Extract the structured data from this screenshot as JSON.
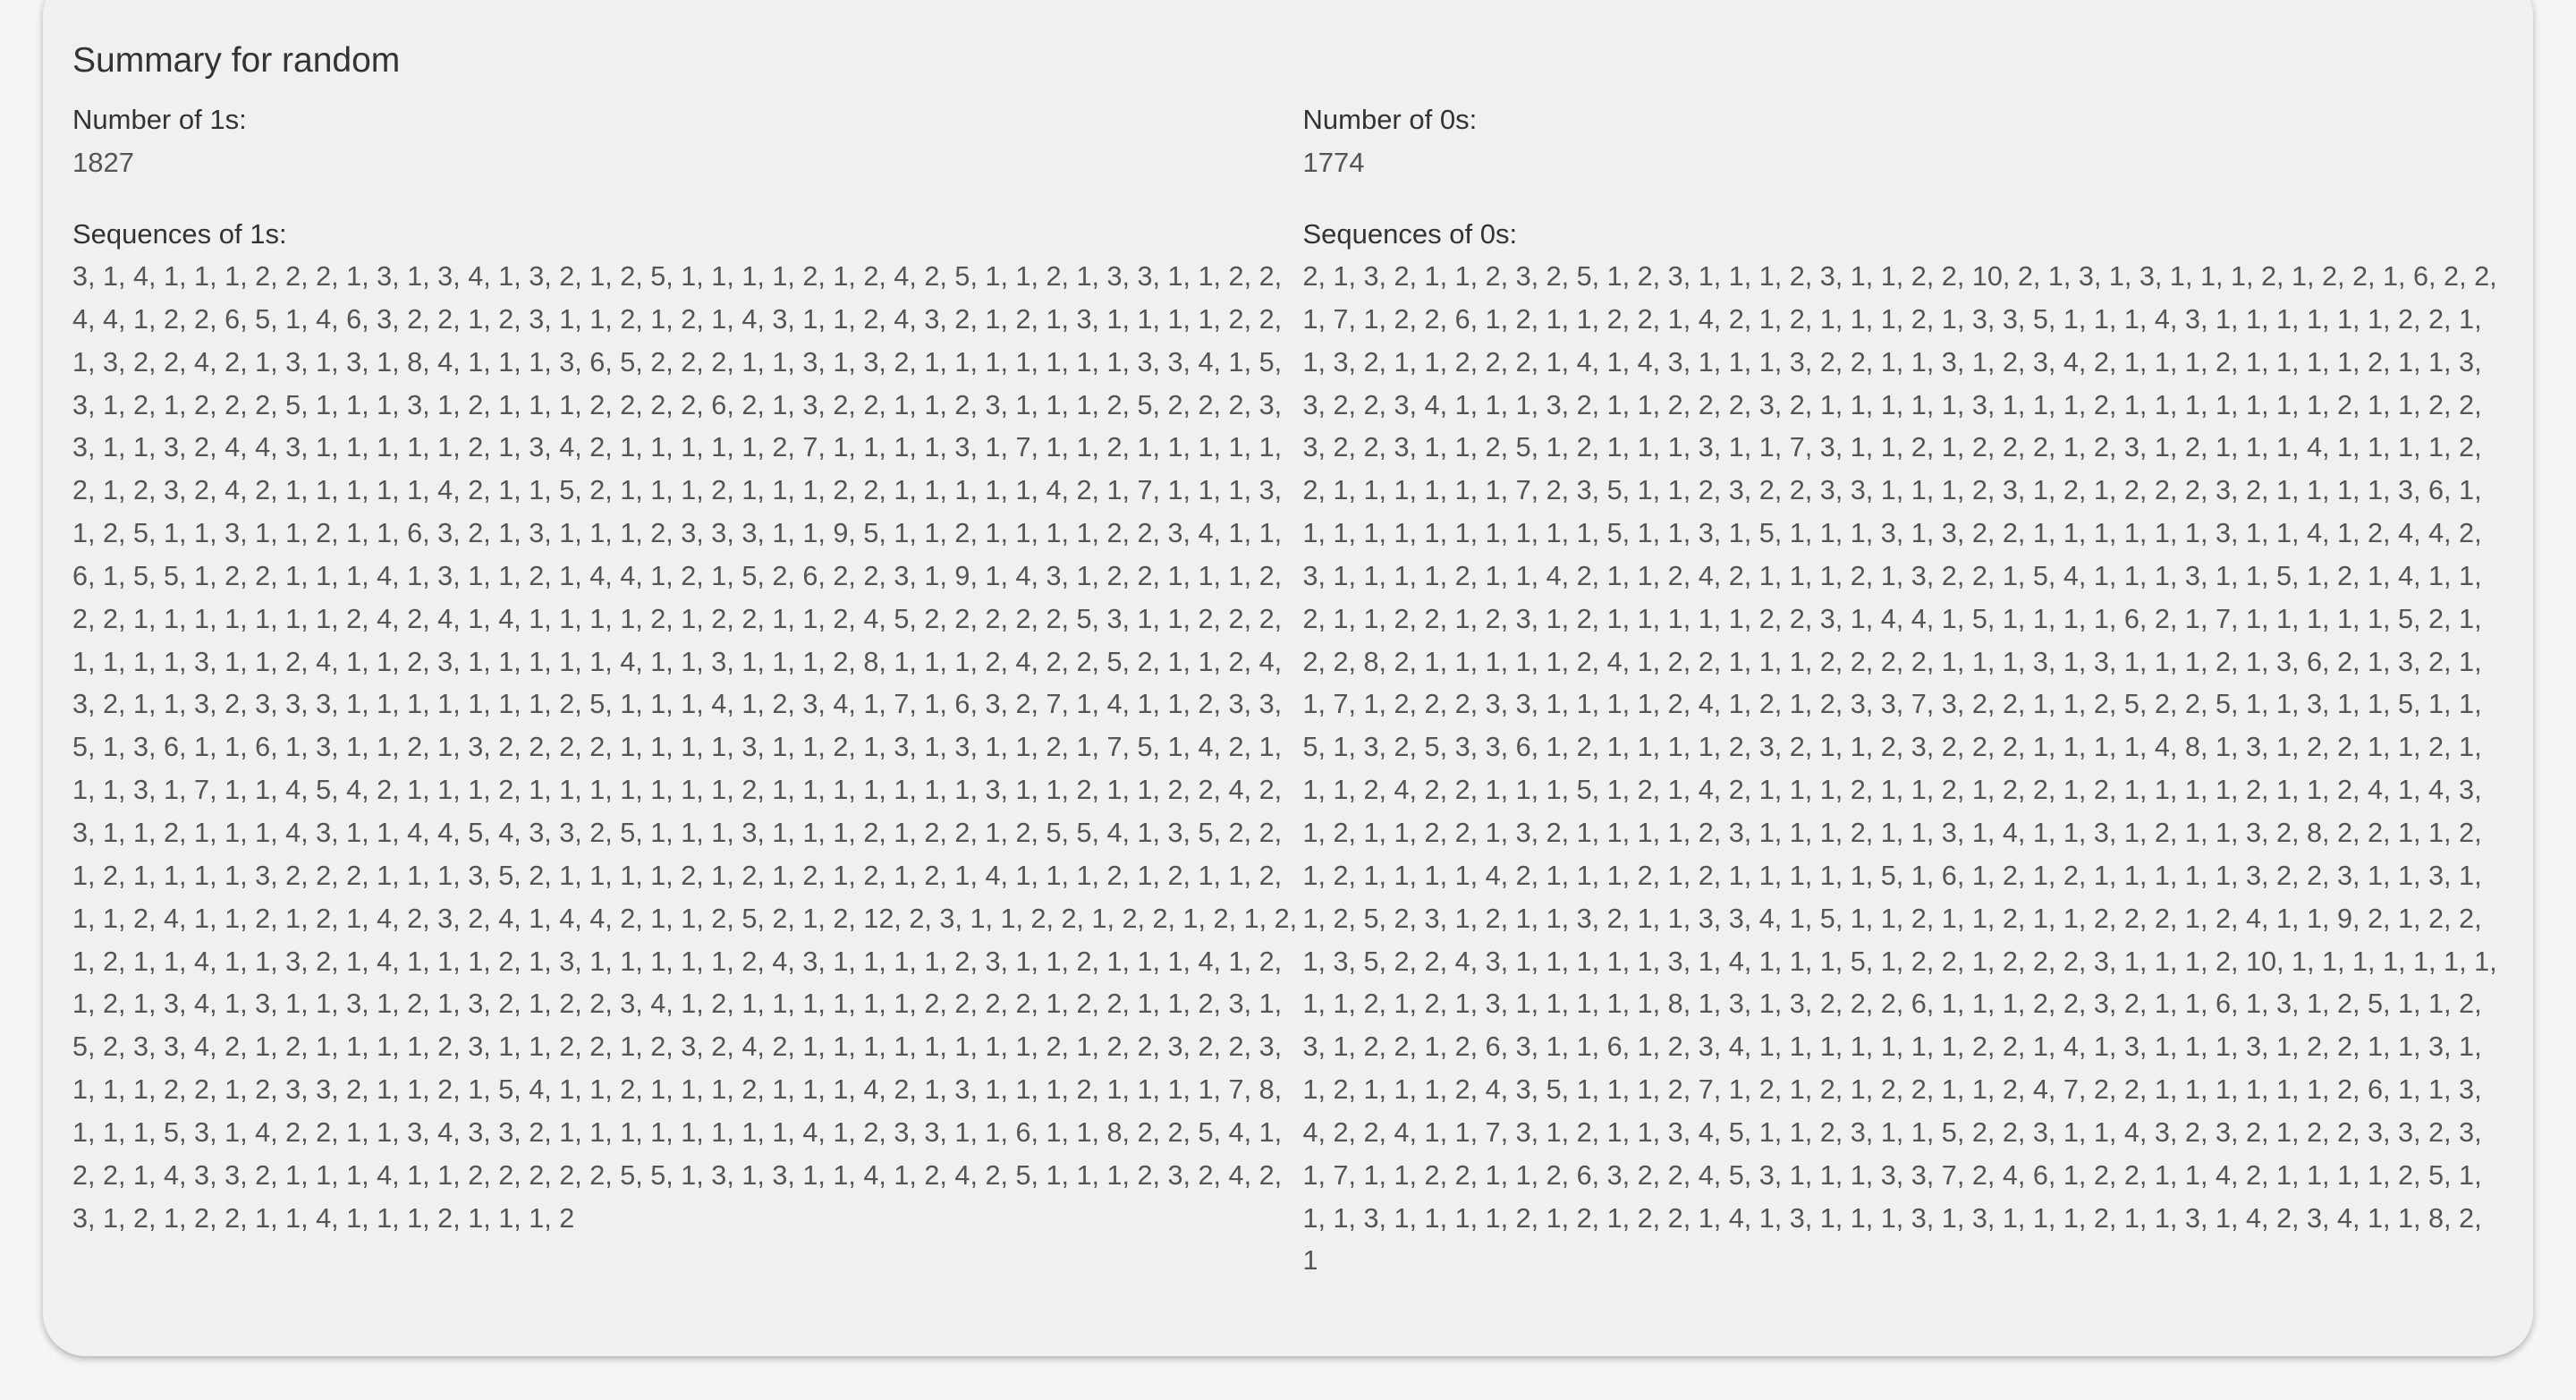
{
  "summary": {
    "title": "Summary for random",
    "ones": {
      "count_label": "Number of 1s:",
      "count": "1827",
      "sequences_label": "Sequences of 1s:",
      "sequences": "3, 1, 4, 1, 1, 1, 2, 2, 2, 1, 3, 1, 3, 4, 1, 3, 2, 1, 2, 5, 1, 1, 1, 1, 2, 1, 2, 4, 2, 5, 1, 1, 2, 1, 3, 3, 1, 1, 2, 2, 4, 4, 1, 2, 2, 6, 5, 1, 4, 6, 3, 2, 2, 1, 2, 3, 1, 1, 2, 1, 2, 1, 4, 3, 1, 1, 2, 4, 3, 2, 1, 2, 1, 3, 1, 1, 1, 1, 2, 2, 1, 3, 2, 2, 4, 2, 1, 3, 1, 3, 1, 8, 4, 1, 1, 1, 3, 6, 5, 2, 2, 2, 1, 1, 3, 1, 3, 2, 1, 1, 1, 1, 1, 1, 1, 3, 3, 4, 1, 5, 3, 1, 2, 1, 2, 2, 2, 5, 1, 1, 1, 3, 1, 2, 1, 1, 1, 2, 2, 2, 2, 6, 2, 1, 3, 2, 2, 1, 1, 2, 3, 1, 1, 1, 2, 5, 2, 2, 2, 3, 3, 1, 1, 3, 2, 4, 4, 3, 1, 1, 1, 1, 1, 2, 1, 3, 4, 2, 1, 1, 1, 1, 1, 2, 7, 1, 1, 1, 1, 3, 1, 7, 1, 1, 2, 1, 1, 1, 1, 1, 2, 1, 2, 3, 2, 4, 2, 1, 1, 1, 1, 1, 4, 2, 1, 1, 5, 2, 1, 1, 1, 2, 1, 1, 1, 2, 2, 1, 1, 1, 1, 1, 4, 2, 1, 7, 1, 1, 1, 3, 1, 2, 5, 1, 1, 3, 1, 1, 2, 1, 1, 6, 3, 2, 1, 3, 1, 1, 1, 2, 3, 3, 3, 1, 1, 9, 5, 1, 1, 2, 1, 1, 1, 1, 2, 2, 3, 4, 1, 1, 6, 1, 5, 5, 1, 2, 2, 1, 1, 1, 4, 1, 3, 1, 1, 2, 1, 4, 4, 1, 2, 1, 5, 2, 6, 2, 2, 3, 1, 9, 1, 4, 3, 1, 2, 2, 1, 1, 1, 2, 2, 2, 1, 1, 1, 1, 1, 1, 1, 2, 4, 2, 4, 1, 4, 1, 1, 1, 1, 2, 1, 2, 2, 1, 1, 2, 4, 5, 2, 2, 2, 2, 2, 5, 3, 1, 1, 2, 2, 2, 1, 1, 1, 1, 3, 1, 1, 2, 4, 1, 1, 2, 3, 1, 1, 1, 1, 1, 4, 1, 1, 3, 1, 1, 1, 2, 8, 1, 1, 1, 2, 4, 2, 2, 5, 2, 1, 1, 2, 4, 3, 2, 1, 1, 3, 2, 3, 3, 3, 1, 1, 1, 1, 1, 1, 1, 2, 5, 1, 1, 1, 4, 1, 2, 3, 4, 1, 7, 1, 6, 3, 2, 7, 1, 4, 1, 1, 2, 3, 3, 5, 1, 3, 6, 1, 1, 6, 1, 3, 1, 1, 2, 1, 3, 2, 2, 2, 2, 1, 1, 1, 1, 3, 1, 1, 2, 1, 3, 1, 3, 1, 1, 2, 1, 7, 5, 1, 4, 2, 1, 1, 1, 3, 1, 7, 1, 1, 4, 5, 4, 2, 1, 1, 1, 2, 1, 1, 1, 1, 1, 1, 1, 2, 1, 1, 1, 1, 1, 1, 1, 3, 1, 1, 2, 1, 1, 2, 2, 4, 2, 3, 1, 1, 2, 1, 1, 1, 4, 3, 1, 1, 4, 4, 5, 4, 3, 3, 2, 5, 1, 1, 1, 3, 1, 1, 1, 2, 1, 2, 2, 1, 2, 5, 5, 4, 1, 3, 5, 2, 2, 1, 2, 1, 1, 1, 1, 3, 2, 2, 2, 1, 1, 1, 3, 5, 2, 1, 1, 1, 1, 2, 1, 2, 1, 2, 1, 2, 1, 2, 1, 4, 1, 1, 1, 2, 1, 2, 1, 1, 2, 1, 1, 2, 4, 1, 1, 2, 1, 2, 1, 4, 2, 3, 2, 4, 1, 4, 4, 2, 1, 1, 2, 5, 2, 1, 2, 12, 2, 3, 1, 1, 2, 2, 1, 2, 2, 1, 2, 1, 2, 1, 2, 1, 1, 4, 1, 1, 3, 2, 1, 4, 1, 1, 1, 2, 1, 3, 1, 1, 1, 1, 1, 2, 4, 3, 1, 1, 1, 1, 2, 3, 1, 1, 2, 1, 1, 1, 4, 1, 2, 1, 2, 1, 3, 4, 1, 3, 1, 1, 3, 1, 2, 1, 3, 2, 1, 2, 2, 3, 4, 1, 2, 1, 1, 1, 1, 1, 1, 2, 2, 2, 2, 1, 2, 2, 1, 1, 2, 3, 1, 5, 2, 3, 3, 4, 2, 1, 2, 1, 1, 1, 1, 2, 3, 1, 1, 2, 2, 1, 2, 3, 2, 4, 2, 1, 1, 1, 1, 1, 1, 1, 1, 2, 1, 2, 2, 3, 2, 2, 3, 1, 1, 1, 2, 2, 1, 2, 3, 3, 2, 1, 1, 2, 1, 5, 4, 1, 1, 2, 1, 1, 1, 2, 1, 1, 1, 4, 2, 1, 3, 1, 1, 1, 2, 1, 1, 1, 1, 7, 8, 1, 1, 1, 5, 3, 1, 4, 2, 2, 1, 1, 3, 4, 3, 3, 2, 1, 1, 1, 1, 1, 1, 1, 1, 4, 1, 2, 3, 3, 1, 1, 6, 1, 1, 8, 2, 2, 5, 4, 1, 2, 2, 1, 4, 3, 3, 2, 1, 1, 1, 4, 1, 1, 2, 2, 2, 2, 2, 5, 5, 1, 3, 1, 3, 1, 1, 4, 1, 2, 4, 2, 5, 1, 1, 1, 2, 3, 2, 4, 2, 3, 1, 2, 1, 2, 2, 1, 1, 4, 1, 1, 1, 2, 1, 1, 1, 2"
    },
    "zeros": {
      "count_label": "Number of 0s:",
      "count": "1774",
      "sequences_label": "Sequences of 0s:",
      "sequences": "2, 1, 3, 2, 1, 1, 2, 3, 2, 5, 1, 2, 3, 1, 1, 1, 2, 3, 1, 1, 2, 2, 10, 2, 1, 3, 1, 3, 1, 1, 1, 2, 1, 2, 2, 1, 6, 2, 2, 1, 7, 1, 2, 2, 6, 1, 2, 1, 1, 2, 2, 1, 4, 2, 1, 2, 1, 1, 1, 2, 1, 3, 3, 5, 1, 1, 1, 4, 3, 1, 1, 1, 1, 1, 1, 2, 2, 1, 1, 3, 2, 1, 1, 2, 2, 2, 1, 4, 1, 4, 3, 1, 1, 1, 3, 2, 2, 1, 1, 3, 1, 2, 3, 4, 2, 1, 1, 1, 2, 1, 1, 1, 1, 2, 1, 1, 3, 3, 2, 2, 3, 4, 1, 1, 1, 3, 2, 1, 1, 2, 2, 2, 3, 2, 1, 1, 1, 1, 1, 3, 1, 1, 1, 2, 1, 1, 1, 1, 1, 1, 1, 2, 1, 1, 2, 2, 3, 2, 2, 3, 1, 1, 2, 5, 1, 2, 1, 1, 1, 3, 1, 1, 7, 3, 1, 1, 2, 1, 2, 2, 2, 1, 2, 3, 1, 2, 1, 1, 1, 4, 1, 1, 1, 1, 2, 2, 1, 1, 1, 1, 1, 1, 7, 2, 3, 5, 1, 1, 2, 3, 2, 2, 3, 3, 1, 1, 1, 2, 3, 1, 2, 1, 2, 2, 2, 3, 2, 1, 1, 1, 1, 3, 6, 1, 1, 1, 1, 1, 1, 1, 1, 1, 1, 1, 5, 1, 1, 3, 1, 5, 1, 1, 1, 3, 1, 3, 2, 2, 1, 1, 1, 1, 1, 1, 3, 1, 1, 4, 1, 2, 4, 4, 2, 3, 1, 1, 1, 1, 2, 1, 1, 4, 2, 1, 1, 2, 4, 2, 1, 1, 1, 2, 1, 3, 2, 2, 1, 5, 4, 1, 1, 1, 3, 1, 1, 5, 1, 2, 1, 4, 1, 1, 2, 1, 1, 2, 2, 1, 2, 3, 1, 2, 1, 1, 1, 1, 1, 2, 2, 3, 1, 4, 4, 1, 5, 1, 1, 1, 1, 6, 2, 1, 7, 1, 1, 1, 1, 1, 5, 2, 1, 2, 2, 8, 2, 1, 1, 1, 1, 1, 2, 4, 1, 2, 2, 1, 1, 1, 2, 2, 2, 2, 1, 1, 1, 3, 1, 3, 1, 1, 1, 2, 1, 3, 6, 2, 1, 3, 2, 1, 1, 7, 1, 2, 2, 2, 3, 3, 1, 1, 1, 1, 2, 4, 1, 2, 1, 2, 3, 3, 7, 3, 2, 2, 1, 1, 2, 5, 2, 2, 5, 1, 1, 3, 1, 1, 5, 1, 1, 5, 1, 3, 2, 5, 3, 3, 6, 1, 2, 1, 1, 1, 1, 2, 3, 2, 1, 1, 2, 3, 2, 2, 2, 1, 1, 1, 1, 4, 8, 1, 3, 1, 2, 2, 1, 1, 2, 1, 1, 1, 2, 4, 2, 2, 1, 1, 1, 5, 1, 2, 1, 4, 2, 1, 1, 1, 2, 1, 1, 2, 1, 2, 2, 1, 2, 1, 1, 1, 1, 2, 1, 1, 2, 4, 1, 4, 3, 1, 2, 1, 1, 2, 2, 1, 3, 2, 1, 1, 1, 1, 2, 3, 1, 1, 1, 2, 1, 1, 3, 1, 4, 1, 1, 3, 1, 2, 1, 1, 3, 2, 8, 2, 2, 1, 1, 2, 1, 2, 1, 1, 1, 1, 4, 2, 1, 1, 1, 2, 1, 2, 1, 1, 1, 1, 1, 5, 1, 6, 1, 2, 1, 2, 1, 1, 1, 1, 1, 3, 2, 2, 3, 1, 1, 3, 1, 1, 2, 5, 2, 3, 1, 2, 1, 1, 3, 2, 1, 1, 3, 3, 4, 1, 5, 1, 1, 2, 1, 1, 2, 1, 1, 2, 2, 2, 1, 2, 4, 1, 1, 9, 2, 1, 2, 2, 1, 3, 5, 2, 2, 4, 3, 1, 1, 1, 1, 1, 3, 1, 4, 1, 1, 1, 5, 1, 2, 2, 1, 2, 2, 2, 3, 1, 1, 1, 2, 10, 1, 1, 1, 1, 1, 1, 1, 1, 1, 2, 1, 2, 1, 3, 1, 1, 1, 1, 1, 8, 1, 3, 1, 3, 2, 2, 2, 6, 1, 1, 1, 2, 2, 3, 2, 1, 1, 6, 1, 3, 1, 2, 5, 1, 1, 2, 3, 1, 2, 2, 1, 2, 6, 3, 1, 1, 6, 1, 2, 3, 4, 1, 1, 1, 1, 1, 1, 1, 2, 2, 1, 4, 1, 3, 1, 1, 1, 3, 1, 2, 2, 1, 1, 3, 1, 1, 2, 1, 1, 1, 2, 4, 3, 5, 1, 1, 1, 2, 7, 1, 2, 1, 2, 1, 2, 2, 1, 1, 2, 4, 7, 2, 2, 1, 1, 1, 1, 1, 1, 2, 6, 1, 1, 3, 4, 2, 2, 4, 1, 1, 7, 3, 1, 2, 1, 1, 3, 4, 5, 1, 1, 2, 3, 1, 1, 5, 2, 2, 3, 1, 1, 4, 3, 2, 3, 2, 1, 2, 2, 3, 3, 2, 3, 1, 7, 1, 1, 2, 2, 1, 1, 2, 6, 3, 2, 2, 4, 5, 3, 1, 1, 1, 3, 3, 7, 2, 4, 6, 1, 2, 2, 1, 1, 4, 2, 1, 1, 1, 1, 2, 5, 1, 1, 1, 3, 1, 1, 1, 1, 2, 1, 2, 1, 2, 2, 1, 4, 1, 3, 1, 1, 1, 3, 1, 3, 1, 1, 1, 2, 1, 1, 3, 1, 4, 2, 3, 4, 1, 1, 8, 2, 1"
    }
  }
}
